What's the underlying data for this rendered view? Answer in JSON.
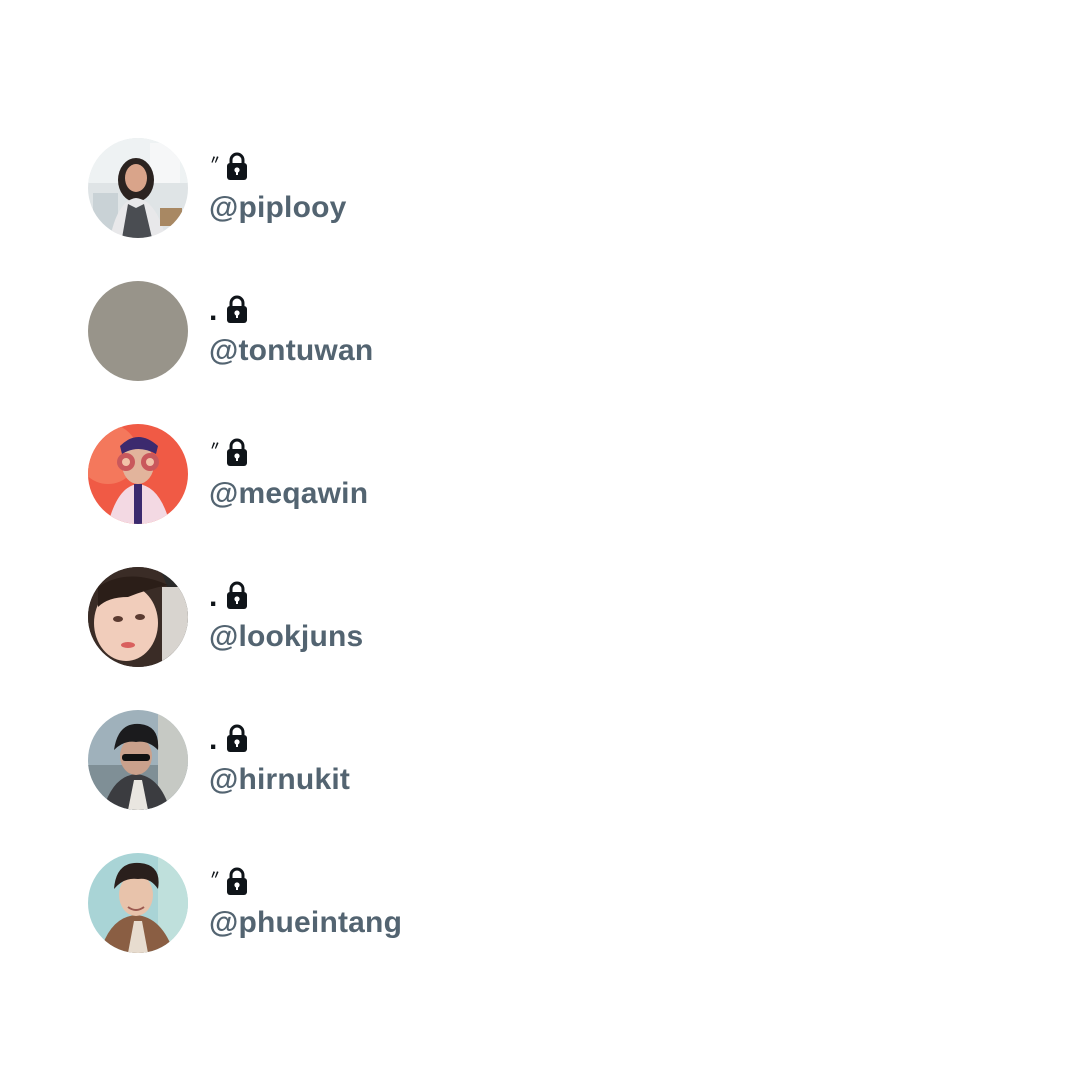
{
  "accounts": [
    {
      "display_name": "〃",
      "handle": "@piplooy",
      "protected": true,
      "avatar": "photo-woman-kitchen"
    },
    {
      "display_name": ".",
      "handle": "@tontuwan",
      "protected": true,
      "avatar": "gray-placeholder",
      "avatar_color": "#98948a"
    },
    {
      "display_name": "〃",
      "handle": "@meqawin",
      "protected": true,
      "avatar": "photo-man-red-background"
    },
    {
      "display_name": ".",
      "handle": "@lookjuns",
      "protected": true,
      "avatar": "photo-woman-closeup"
    },
    {
      "display_name": ".",
      "handle": "@hirnukit",
      "protected": true,
      "avatar": "photo-man-sunglasses"
    },
    {
      "display_name": "〃",
      "handle": "@phueintang",
      "protected": true,
      "avatar": "photo-man-smiling"
    }
  ],
  "colors": {
    "name_text": "#0f1419",
    "handle_text": "#536471",
    "background": "#ffffff"
  },
  "icons": {
    "protected": "lock-icon"
  }
}
